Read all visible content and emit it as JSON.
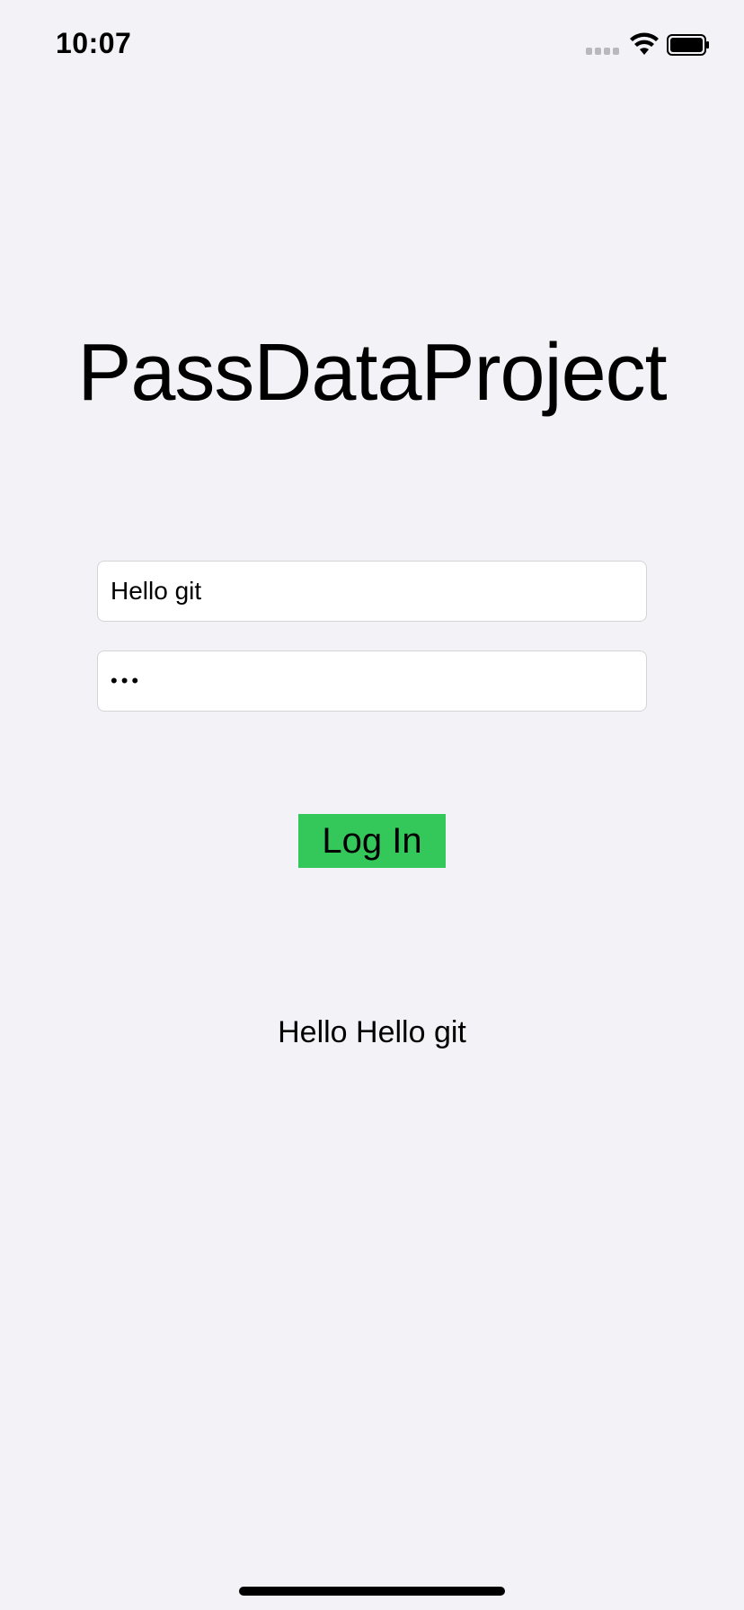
{
  "status_bar": {
    "time": "10:07",
    "icons": [
      "signal-icon",
      "wifi-icon",
      "battery-icon"
    ]
  },
  "app": {
    "title": "PassDataProject"
  },
  "form": {
    "username_value": "Hello git",
    "password_masked": "•••",
    "login_label": "Log In"
  },
  "result": {
    "text": "Hello Hello git"
  },
  "colors": {
    "background": "#f2f2f7",
    "button": "#34c759"
  }
}
